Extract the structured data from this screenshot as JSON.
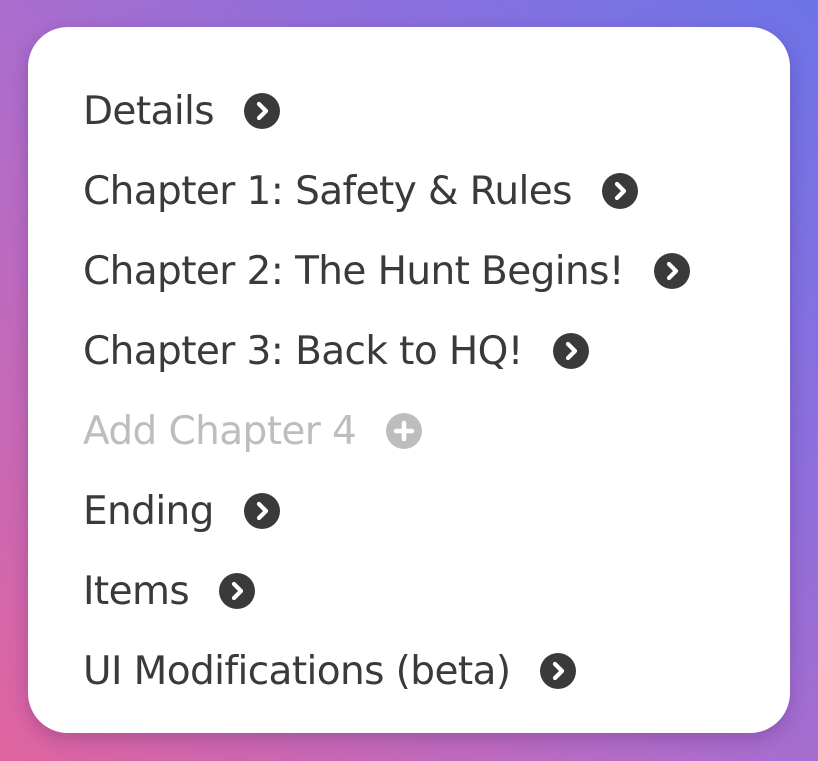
{
  "colors": {
    "text": "#3a3a3c",
    "disabled_text": "#bdbdbd",
    "icon_fill": "#3a3a3c",
    "disabled_icon_fill": "#bdbdbd",
    "card_background": "#ffffff"
  },
  "menu": {
    "items": [
      {
        "label": "Details",
        "icon": "chevron-right-circle-icon"
      },
      {
        "label": "Chapter 1: Safety & Rules",
        "icon": "chevron-right-circle-icon"
      },
      {
        "label": "Chapter 2: The Hunt Begins!",
        "icon": "chevron-right-circle-icon"
      },
      {
        "label": "Chapter 3: Back to HQ!",
        "icon": "chevron-right-circle-icon"
      },
      {
        "label": "Add Chapter 4",
        "icon": "plus-circle-icon",
        "disabled": true
      },
      {
        "label": "Ending",
        "icon": "chevron-right-circle-icon"
      },
      {
        "label": "Items",
        "icon": "chevron-right-circle-icon"
      },
      {
        "label": "UI Modifications (beta)",
        "icon": "chevron-right-circle-icon"
      }
    ]
  }
}
